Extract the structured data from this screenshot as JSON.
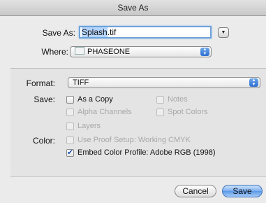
{
  "window": {
    "title": "Save As"
  },
  "save_as": {
    "label": "Save As:",
    "name_selected": "Splash",
    "name_ext": ".tif"
  },
  "where": {
    "label": "Where:",
    "value": "PHASEONE"
  },
  "format": {
    "label": "Format:",
    "value": "TIFF"
  },
  "save": {
    "label": "Save:",
    "options": {
      "as_copy": {
        "label": "As a Copy",
        "checked": false,
        "enabled": true
      },
      "notes": {
        "label": "Notes",
        "checked": false,
        "enabled": false
      },
      "alpha_channels": {
        "label": "Alpha Channels",
        "checked": false,
        "enabled": false
      },
      "spot_colors": {
        "label": "Spot Colors",
        "checked": false,
        "enabled": false
      },
      "layers": {
        "label": "Layers",
        "checked": false,
        "enabled": false
      }
    }
  },
  "color": {
    "label": "Color:",
    "proof_setup": {
      "label": "Use Proof Setup:  Working CMYK",
      "checked": false,
      "enabled": false
    },
    "embed_profile": {
      "label": "Embed Color Profile:  Adobe RGB (1998)",
      "checked": true,
      "enabled": true
    }
  },
  "buttons": {
    "cancel": "Cancel",
    "save": "Save"
  },
  "icons": {
    "expand": "expand-down-triangle",
    "folder": "folder-icon",
    "popup": "popup-arrows-icon",
    "check": "checkmark"
  }
}
